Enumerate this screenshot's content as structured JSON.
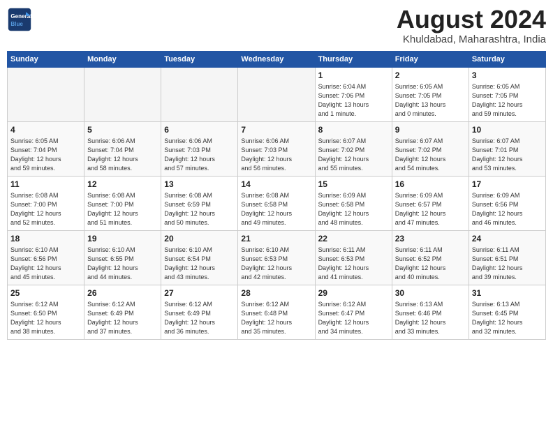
{
  "header": {
    "logo_line1": "General",
    "logo_line2": "Blue",
    "month_year": "August 2024",
    "location": "Khuldabad, Maharashtra, India"
  },
  "weekdays": [
    "Sunday",
    "Monday",
    "Tuesday",
    "Wednesday",
    "Thursday",
    "Friday",
    "Saturday"
  ],
  "weeks": [
    [
      {
        "day": "",
        "info": ""
      },
      {
        "day": "",
        "info": ""
      },
      {
        "day": "",
        "info": ""
      },
      {
        "day": "",
        "info": ""
      },
      {
        "day": "1",
        "info": "Sunrise: 6:04 AM\nSunset: 7:06 PM\nDaylight: 13 hours\nand 1 minute."
      },
      {
        "day": "2",
        "info": "Sunrise: 6:05 AM\nSunset: 7:05 PM\nDaylight: 13 hours\nand 0 minutes."
      },
      {
        "day": "3",
        "info": "Sunrise: 6:05 AM\nSunset: 7:05 PM\nDaylight: 12 hours\nand 59 minutes."
      }
    ],
    [
      {
        "day": "4",
        "info": "Sunrise: 6:05 AM\nSunset: 7:04 PM\nDaylight: 12 hours\nand 59 minutes."
      },
      {
        "day": "5",
        "info": "Sunrise: 6:06 AM\nSunset: 7:04 PM\nDaylight: 12 hours\nand 58 minutes."
      },
      {
        "day": "6",
        "info": "Sunrise: 6:06 AM\nSunset: 7:03 PM\nDaylight: 12 hours\nand 57 minutes."
      },
      {
        "day": "7",
        "info": "Sunrise: 6:06 AM\nSunset: 7:03 PM\nDaylight: 12 hours\nand 56 minutes."
      },
      {
        "day": "8",
        "info": "Sunrise: 6:07 AM\nSunset: 7:02 PM\nDaylight: 12 hours\nand 55 minutes."
      },
      {
        "day": "9",
        "info": "Sunrise: 6:07 AM\nSunset: 7:02 PM\nDaylight: 12 hours\nand 54 minutes."
      },
      {
        "day": "10",
        "info": "Sunrise: 6:07 AM\nSunset: 7:01 PM\nDaylight: 12 hours\nand 53 minutes."
      }
    ],
    [
      {
        "day": "11",
        "info": "Sunrise: 6:08 AM\nSunset: 7:00 PM\nDaylight: 12 hours\nand 52 minutes."
      },
      {
        "day": "12",
        "info": "Sunrise: 6:08 AM\nSunset: 7:00 PM\nDaylight: 12 hours\nand 51 minutes."
      },
      {
        "day": "13",
        "info": "Sunrise: 6:08 AM\nSunset: 6:59 PM\nDaylight: 12 hours\nand 50 minutes."
      },
      {
        "day": "14",
        "info": "Sunrise: 6:08 AM\nSunset: 6:58 PM\nDaylight: 12 hours\nand 49 minutes."
      },
      {
        "day": "15",
        "info": "Sunrise: 6:09 AM\nSunset: 6:58 PM\nDaylight: 12 hours\nand 48 minutes."
      },
      {
        "day": "16",
        "info": "Sunrise: 6:09 AM\nSunset: 6:57 PM\nDaylight: 12 hours\nand 47 minutes."
      },
      {
        "day": "17",
        "info": "Sunrise: 6:09 AM\nSunset: 6:56 PM\nDaylight: 12 hours\nand 46 minutes."
      }
    ],
    [
      {
        "day": "18",
        "info": "Sunrise: 6:10 AM\nSunset: 6:56 PM\nDaylight: 12 hours\nand 45 minutes."
      },
      {
        "day": "19",
        "info": "Sunrise: 6:10 AM\nSunset: 6:55 PM\nDaylight: 12 hours\nand 44 minutes."
      },
      {
        "day": "20",
        "info": "Sunrise: 6:10 AM\nSunset: 6:54 PM\nDaylight: 12 hours\nand 43 minutes."
      },
      {
        "day": "21",
        "info": "Sunrise: 6:10 AM\nSunset: 6:53 PM\nDaylight: 12 hours\nand 42 minutes."
      },
      {
        "day": "22",
        "info": "Sunrise: 6:11 AM\nSunset: 6:53 PM\nDaylight: 12 hours\nand 41 minutes."
      },
      {
        "day": "23",
        "info": "Sunrise: 6:11 AM\nSunset: 6:52 PM\nDaylight: 12 hours\nand 40 minutes."
      },
      {
        "day": "24",
        "info": "Sunrise: 6:11 AM\nSunset: 6:51 PM\nDaylight: 12 hours\nand 39 minutes."
      }
    ],
    [
      {
        "day": "25",
        "info": "Sunrise: 6:12 AM\nSunset: 6:50 PM\nDaylight: 12 hours\nand 38 minutes."
      },
      {
        "day": "26",
        "info": "Sunrise: 6:12 AM\nSunset: 6:49 PM\nDaylight: 12 hours\nand 37 minutes."
      },
      {
        "day": "27",
        "info": "Sunrise: 6:12 AM\nSunset: 6:49 PM\nDaylight: 12 hours\nand 36 minutes."
      },
      {
        "day": "28",
        "info": "Sunrise: 6:12 AM\nSunset: 6:48 PM\nDaylight: 12 hours\nand 35 minutes."
      },
      {
        "day": "29",
        "info": "Sunrise: 6:12 AM\nSunset: 6:47 PM\nDaylight: 12 hours\nand 34 minutes."
      },
      {
        "day": "30",
        "info": "Sunrise: 6:13 AM\nSunset: 6:46 PM\nDaylight: 12 hours\nand 33 minutes."
      },
      {
        "day": "31",
        "info": "Sunrise: 6:13 AM\nSunset: 6:45 PM\nDaylight: 12 hours\nand 32 minutes."
      }
    ]
  ]
}
